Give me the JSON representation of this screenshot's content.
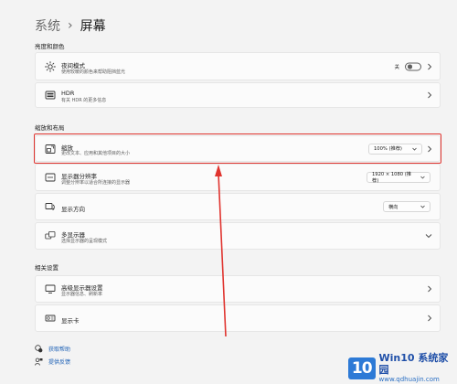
{
  "breadcrumb": {
    "parent": "系统",
    "separator": "›",
    "current": "屏幕"
  },
  "sections": {
    "brightness": "亮度和颜色",
    "scale_layout": "缩放和布局",
    "related": "相关设置"
  },
  "rows": {
    "night_light": {
      "title": "夜间模式",
      "subtitle": "使用较暖的颜色来帮助阻挡蓝光",
      "toggle_label": "关",
      "icon": "sun-icon"
    },
    "hdr": {
      "title": "HDR",
      "subtitle": "有关 HDR 的更多信息",
      "icon": "hdr-icon"
    },
    "scale": {
      "title": "缩放",
      "subtitle": "更改文本、应用和其他项目的大小",
      "value": "100% (推荐)",
      "icon": "scale-icon"
    },
    "resolution": {
      "title": "显示器分辨率",
      "subtitle": "调整分辨率以适合所连接的显示器",
      "value": "1920 × 1080 (推荐)",
      "icon": "resolution-icon"
    },
    "orientation": {
      "title": "显示方向",
      "value": "横向",
      "icon": "orientation-icon"
    },
    "multi": {
      "title": "多显示器",
      "subtitle": "选择显示器的呈现模式",
      "icon": "multi-display-icon"
    },
    "advanced": {
      "title": "高级显示器设置",
      "subtitle": "显示器信息、刷新率",
      "icon": "monitor-icon"
    },
    "gpu": {
      "title": "显示卡",
      "icon": "gpu-icon"
    }
  },
  "links": {
    "help": "获取帮助",
    "feedback": "提供反馈"
  },
  "watermark": {
    "logo": "10",
    "brand": "Win10 系统家园",
    "url": "www.qdhuajin.com"
  },
  "colors": {
    "highlight": "#e0342f",
    "link": "#1b5fb5",
    "brand": "#2d7ad6"
  }
}
